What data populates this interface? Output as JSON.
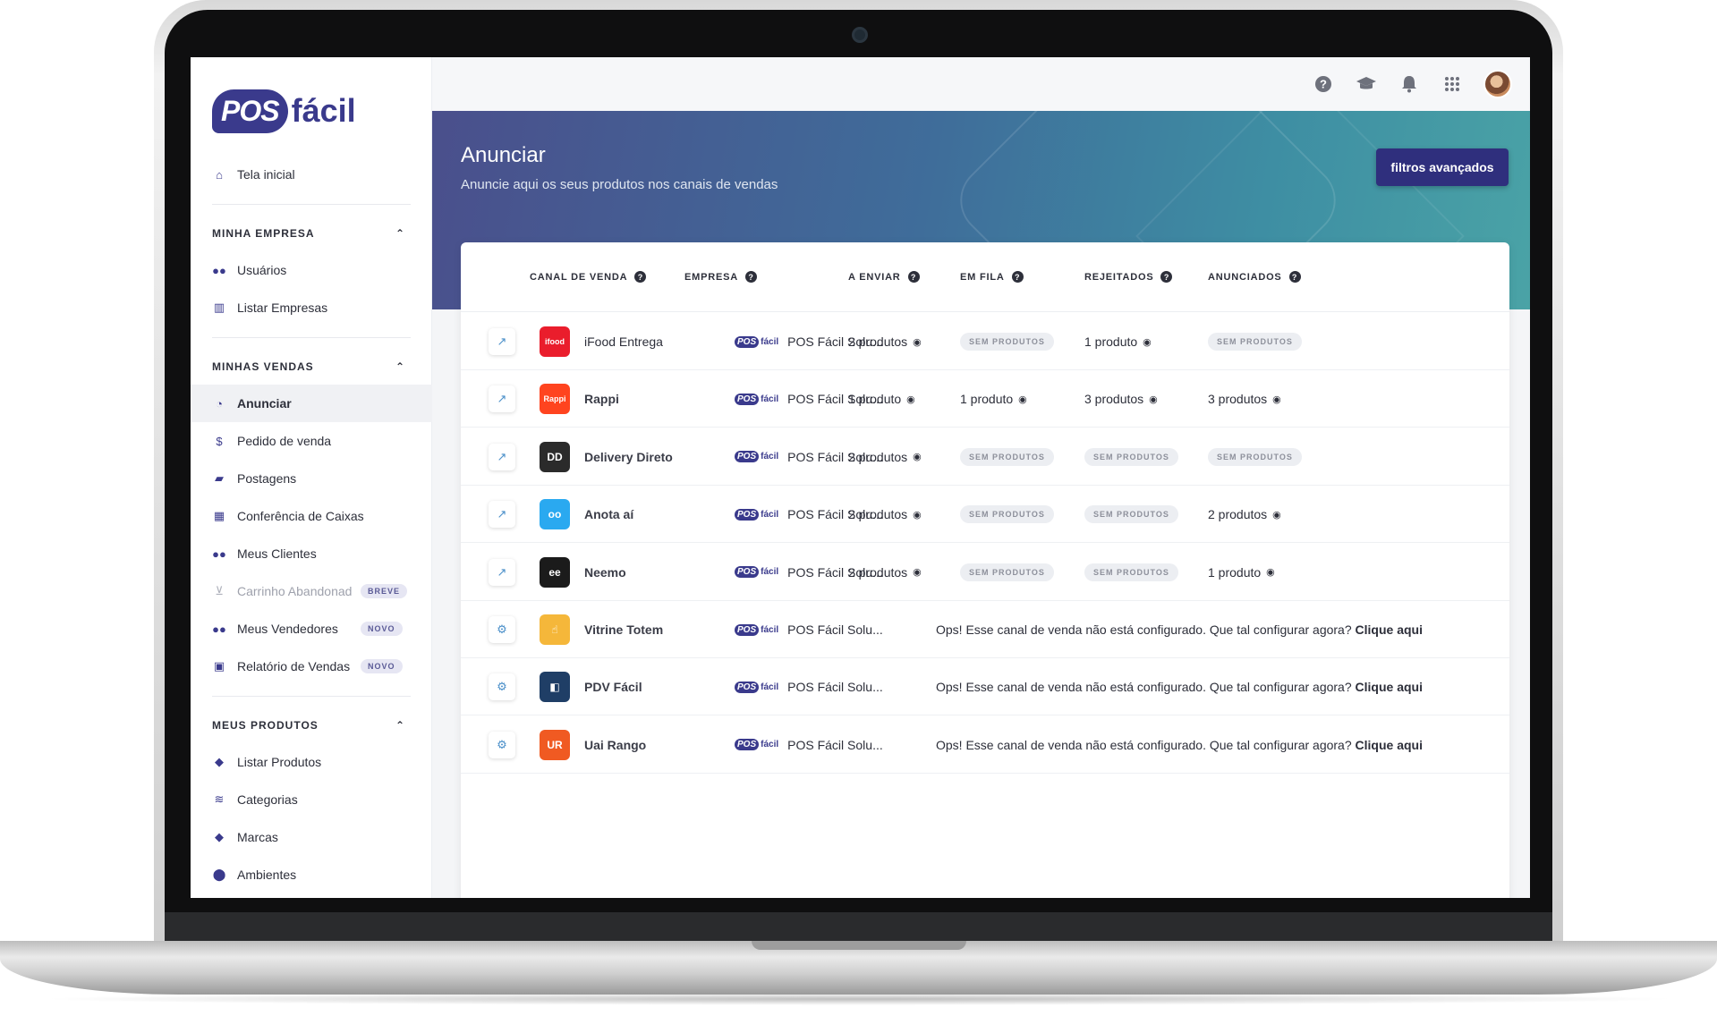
{
  "brand": {
    "logo_pos": "POS",
    "logo_facil": "fácil"
  },
  "sidebar": {
    "home": "Tela inicial",
    "sections": [
      {
        "title": "MINHA EMPRESA",
        "items": [
          {
            "label": "Usuários",
            "icon": "users-icon"
          },
          {
            "label": "Listar Empresas",
            "icon": "building-icon"
          }
        ]
      },
      {
        "title": "MINHAS VENDAS",
        "items": [
          {
            "label": "Anunciar",
            "icon": "megaphone-icon",
            "active": true
          },
          {
            "label": "Pedido de venda",
            "icon": "dollar-icon"
          },
          {
            "label": "Postagens",
            "icon": "truck-icon"
          },
          {
            "label": "Conferência de Caixas",
            "icon": "cash-register-icon"
          },
          {
            "label": "Meus Clientes",
            "icon": "users-icon"
          },
          {
            "label": "Carrinho Abandonado",
            "icon": "cart-icon",
            "badge": "BREVE",
            "disabled": true
          },
          {
            "label": "Meus Vendedores",
            "icon": "users-icon",
            "badge": "NOVO"
          },
          {
            "label": "Relatório de Vendas",
            "icon": "calendar-icon",
            "badge": "NOVO"
          }
        ]
      },
      {
        "title": "MEUS PRODUTOS",
        "items": [
          {
            "label": "Listar Produtos",
            "icon": "tag-icon"
          },
          {
            "label": "Categorias",
            "icon": "layers-icon"
          },
          {
            "label": "Marcas",
            "icon": "tag-icon"
          },
          {
            "label": "Ambientes",
            "icon": "pin-icon"
          }
        ]
      }
    ]
  },
  "topbar": {
    "icons": [
      "help-icon",
      "graduation-cap-icon",
      "bell-icon",
      "apps-grid-icon"
    ]
  },
  "hero": {
    "title": "Anunciar",
    "subtitle": "Anuncie aqui os seus produtos nos canais de vendas",
    "button": "filtros avançados"
  },
  "table": {
    "headers": [
      "CANAL DE VENDA",
      "EMPRESA",
      "A ENVIAR",
      "EM FILA",
      "REJEITADOS",
      "ANUNCIADOS"
    ],
    "company": "POS Fácil Solu...",
    "empty_label": "SEM PRODUTOS",
    "not_configured_msg": "Ops! Esse canal de venda não está configurado. Que tal configurar agora?",
    "configure_link": "Clique aqui",
    "rows": [
      {
        "channel": "iFood Entrega",
        "logo_color": "#ea1d2c",
        "logo_text": "ifood",
        "action": "external",
        "a_enviar": "2 produtos",
        "em_fila": "SEM PRODUTOS",
        "rejeitados": "1 produto",
        "anunciados": "SEM PRODUTOS"
      },
      {
        "channel": "Rappi",
        "logo_color": "#ff441f",
        "logo_text": "Rappi",
        "action": "external",
        "a_enviar": "1 produto",
        "em_fila": "1 produto",
        "rejeitados": "3 produtos",
        "anunciados": "3 produtos"
      },
      {
        "channel": "Delivery Direto",
        "logo_color": "#2b2b2b",
        "logo_text": "DD",
        "action": "external",
        "a_enviar": "2 produtos",
        "em_fila": "SEM PRODUTOS",
        "rejeitados": "SEM PRODUTOS",
        "anunciados": "SEM PRODUTOS"
      },
      {
        "channel": "Anota aí",
        "logo_color": "#2aa9f0",
        "logo_text": "oo",
        "action": "external",
        "a_enviar": "2 produtos",
        "em_fila": "SEM PRODUTOS",
        "rejeitados": "SEM PRODUTOS",
        "anunciados": "2 produtos"
      },
      {
        "channel": "Neemo",
        "logo_color": "#1b1b1b",
        "logo_text": "ee",
        "action": "external",
        "a_enviar": "2 produtos",
        "em_fila": "SEM PRODUTOS",
        "rejeitados": "SEM PRODUTOS",
        "anunciados": "1 produto"
      },
      {
        "channel": "Vitrine Totem",
        "logo_color": "#f5b73a",
        "logo_text": "☝",
        "action": "settings",
        "configured": false
      },
      {
        "channel": "PDV Fácil",
        "logo_color": "#1f3e66",
        "logo_text": "◧",
        "action": "settings",
        "configured": false
      },
      {
        "channel": "Uai Rango",
        "logo_color": "#f05a22",
        "logo_text": "UR",
        "action": "settings",
        "configured": false
      }
    ]
  }
}
